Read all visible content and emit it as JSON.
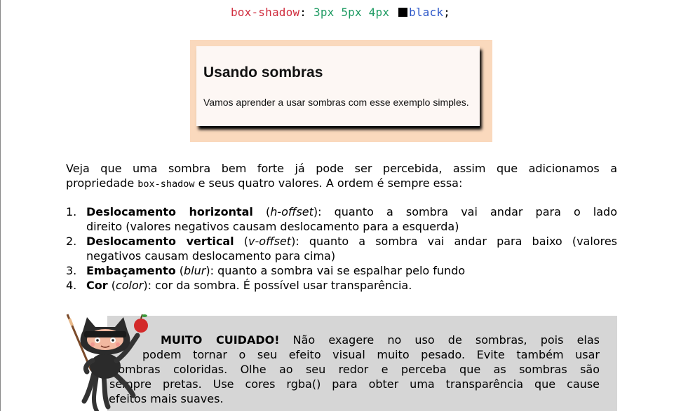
{
  "code": {
    "property": "box-shadow",
    "colon": ":",
    "h_offset": "3px",
    "v_offset": "5px",
    "blur": "4px",
    "color": "black",
    "semicolon": ";"
  },
  "demo": {
    "title": "Usando sombras",
    "text": "Vamos aprender a usar sombras com esse exemplo simples."
  },
  "intro": {
    "line1": "Veja que uma sombra bem forte já pode ser percebida, assim que adicionamos a",
    "pre": "propriedade ",
    "code": "box-shadow",
    "post": " e seus quatro valores. A ordem é sempre essa:"
  },
  "list": [
    {
      "num": "1.",
      "term": "Deslocamento horizontal",
      "open": " (",
      "alias": "h-offset",
      "close": ")",
      "first_rest": ": quanto a sombra vai andar para o lado",
      "second": "direito (valores negativos causam deslocamento para a esquerda)"
    },
    {
      "num": "2.",
      "term": "Deslocamento vertical",
      "open": " (",
      "alias": "v-offset",
      "close": ")",
      "first_rest": ": quanto a sombra vai andar para baixo (valores",
      "second": "negativos causam deslocamento para cima)"
    },
    {
      "num": "3.",
      "term": "Embaçamento",
      "open": " (",
      "alias": "blur",
      "close": ")",
      "rest": ": quanto a sombra vai se espalhar pelo fundo"
    },
    {
      "num": "4.",
      "term": "Cor",
      "open": " (",
      "alias": "color",
      "close": ")",
      "rest": ": cor da sombra. É possível usar transparência."
    }
  ],
  "warning": {
    "strong": "MUITO CUIDADO!",
    "line1_rest": " Não exagere no uso de sombras, pois elas",
    "line2": "podem tornar o seu efeito visual muito pesado. Evite também usar",
    "line3": "sombras coloridas. Olhe ao seu redor e perceba que as sombras são",
    "line4": "sempre pretas. Use cores rgba() para obter uma transparência que cause",
    "line5": "efeitos mais suaves."
  },
  "colors": {
    "property": "#d02d3e",
    "number": "#1f9b63",
    "keyword": "#2b56c8",
    "demo_frame": "#fad9bd",
    "warning_bg": "#d6d6d6"
  },
  "icons": {
    "mascot": "octocat-ninja-icon",
    "swatch": "color-swatch-black"
  }
}
